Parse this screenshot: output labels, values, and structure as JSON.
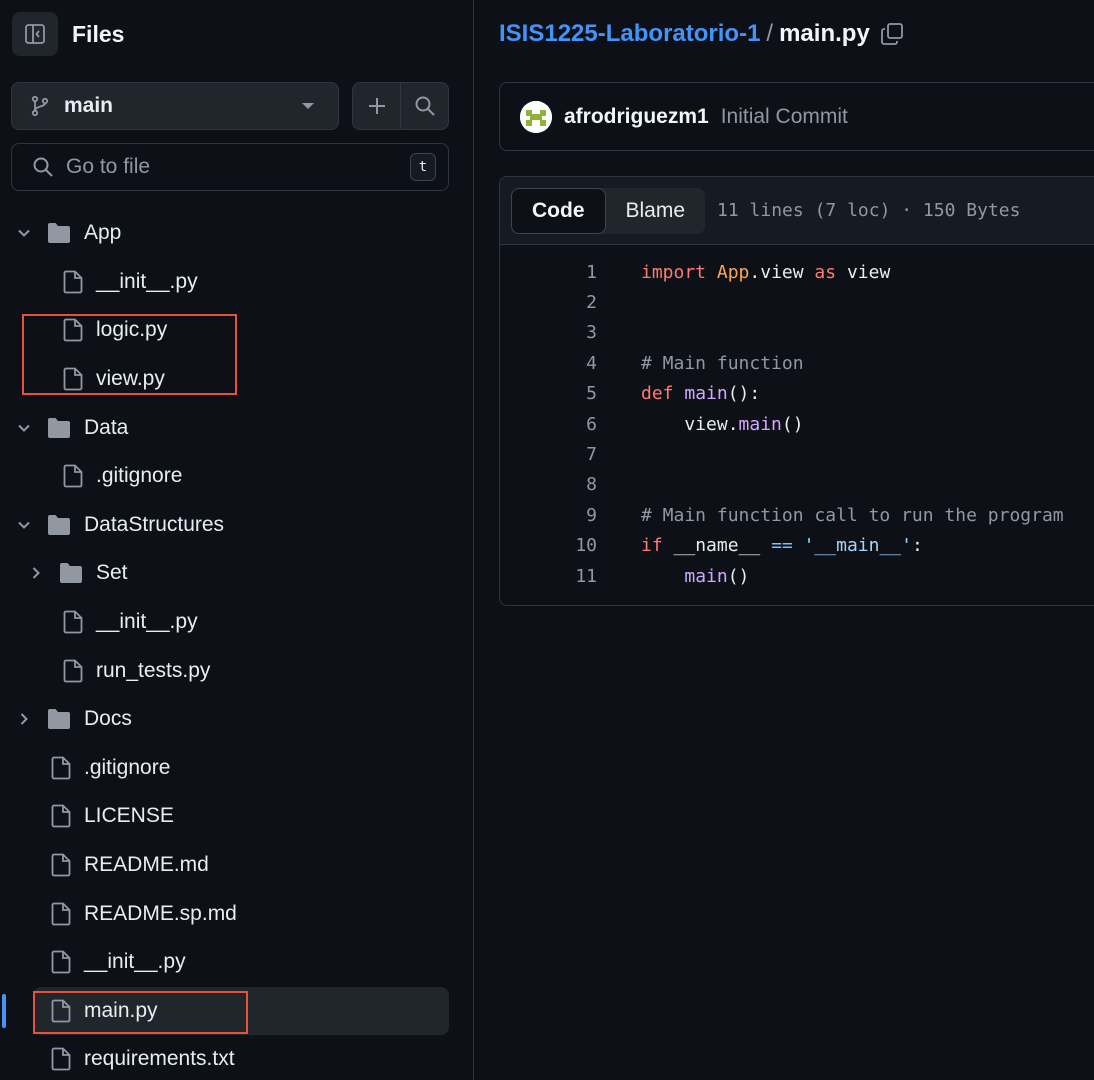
{
  "sidebar": {
    "title": "Files",
    "branch": "main",
    "goto_placeholder": "Go to file",
    "goto_shortcut": "t",
    "tree": [
      {
        "label": "App",
        "type": "folder",
        "expanded": true,
        "depth": 0
      },
      {
        "label": "__init__.py",
        "type": "file",
        "depth": 1
      },
      {
        "label": "logic.py",
        "type": "file",
        "depth": 1
      },
      {
        "label": "view.py",
        "type": "file",
        "depth": 1
      },
      {
        "label": "Data",
        "type": "folder",
        "expanded": true,
        "depth": 0
      },
      {
        "label": ".gitignore",
        "type": "file",
        "depth": 1
      },
      {
        "label": "DataStructures",
        "type": "folder",
        "expanded": true,
        "depth": 0
      },
      {
        "label": "Set",
        "type": "folder",
        "expanded": false,
        "depth": 1
      },
      {
        "label": "__init__.py",
        "type": "file",
        "depth": 1
      },
      {
        "label": "run_tests.py",
        "type": "file",
        "depth": 1
      },
      {
        "label": "Docs",
        "type": "folder",
        "expanded": false,
        "depth": 0
      },
      {
        "label": ".gitignore",
        "type": "file",
        "depth": 0
      },
      {
        "label": "LICENSE",
        "type": "file",
        "depth": 0
      },
      {
        "label": "README.md",
        "type": "file",
        "depth": 0
      },
      {
        "label": "README.sp.md",
        "type": "file",
        "depth": 0
      },
      {
        "label": "__init__.py",
        "type": "file",
        "depth": 0
      },
      {
        "label": "main.py",
        "type": "file",
        "depth": 0,
        "selected": true
      },
      {
        "label": "requirements.txt",
        "type": "file",
        "depth": 0
      }
    ]
  },
  "breadcrumb": {
    "repo": "ISIS1225-Laboratorio-1",
    "separator": "/",
    "file": "main.py"
  },
  "commit": {
    "user": "afrodriguezm1",
    "message": "Initial Commit"
  },
  "code_view": {
    "tabs": [
      "Code",
      "Blame"
    ],
    "active_tab": "Code",
    "file_info": "11 lines (7 loc) · 150 Bytes",
    "lines": [
      "import App.view as view",
      "",
      "",
      "# Main function",
      "def main():",
      "    view.main()",
      "",
      "",
      "# Main function call to run the program",
      "if __name__ == '__main__':",
      "    main()"
    ]
  },
  "colors": {
    "accent": "#4493f8",
    "highlight_box": "#e5533d",
    "background": "#0d1117"
  }
}
